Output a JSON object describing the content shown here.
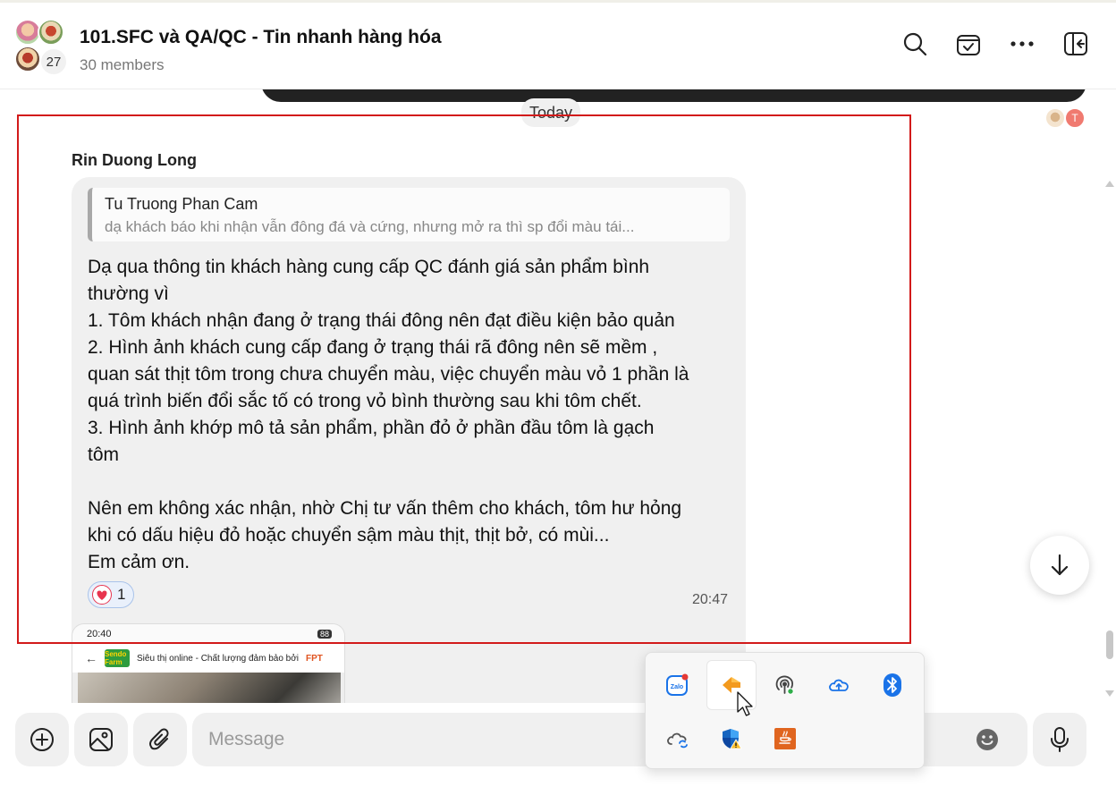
{
  "header": {
    "title": "101.SFC và QA/QC - Tin nhanh hàng hóa",
    "subtitle": "30 members",
    "avatar_count": "27"
  },
  "chat": {
    "date_divider": "Today",
    "seen_badge": "T",
    "message": {
      "sender": "Rin Duong Long",
      "quote": {
        "author": "Tu Truong Phan Cam",
        "text": "dạ khách báo khi nhận vẫn đông đá và cứng, nhưng mở ra thì sp đổi màu tái..."
      },
      "lines": [
        "Dạ qua thông tin khách hàng cung cấp QC đánh giá sản phẩm bình",
        "thường vì",
        "1. Tôm khách nhận đang ở trạng thái đông nên đạt điều kiện bảo quản",
        "2. Hình ảnh khách cung cấp đang ở trạng thái rã đông nên sẽ mềm ,",
        "quan sát thịt tôm trong chưa chuyển màu, việc chuyển màu vỏ 1 phần là",
        "quá trình biến đổi sắc tố có trong vỏ bình thường sau khi tôm chết.",
        "3. Hình ảnh khớp mô tả sản phẩm, phần đỏ ở phần đầu tôm là gạch",
        "tôm",
        "",
        "Nên em không xác nhận, nhờ Chị tư vấn thêm cho khách, tôm hư hỏng",
        "khi có dấu hiệu đỏ hoặc chuyển sậm màu thịt, thịt bở, có mùi...",
        "Em cảm ơn."
      ],
      "reaction_count": "1",
      "time": "20:47"
    },
    "image_preview": {
      "status_time": "20:40",
      "battery": "88",
      "logo_text": "Sendo Farm",
      "banner_text": "Siêu thị online - Chất lượng đảm bảo bởi",
      "brand_text": "FPT"
    }
  },
  "composer": {
    "placeholder": "Message"
  },
  "tray": {
    "items": [
      {
        "name": "zalo-tray-icon",
        "label": "Zalo"
      },
      {
        "name": "orange-app-tray-icon",
        "label": ""
      },
      {
        "name": "hotspot-tray-icon",
        "label": ""
      },
      {
        "name": "onedrive-tray-icon",
        "label": ""
      },
      {
        "name": "bluetooth-tray-icon",
        "label": ""
      },
      {
        "name": "cloud-sync-tray-icon",
        "label": ""
      },
      {
        "name": "security-shield-tray-icon",
        "label": ""
      },
      {
        "name": "java-tray-icon",
        "label": ""
      }
    ]
  },
  "colors": {
    "highlight": "#d21a1a",
    "bubble": "#f0f0f0",
    "reaction_bg": "#e9f0fb",
    "heart": "#e8344e"
  }
}
